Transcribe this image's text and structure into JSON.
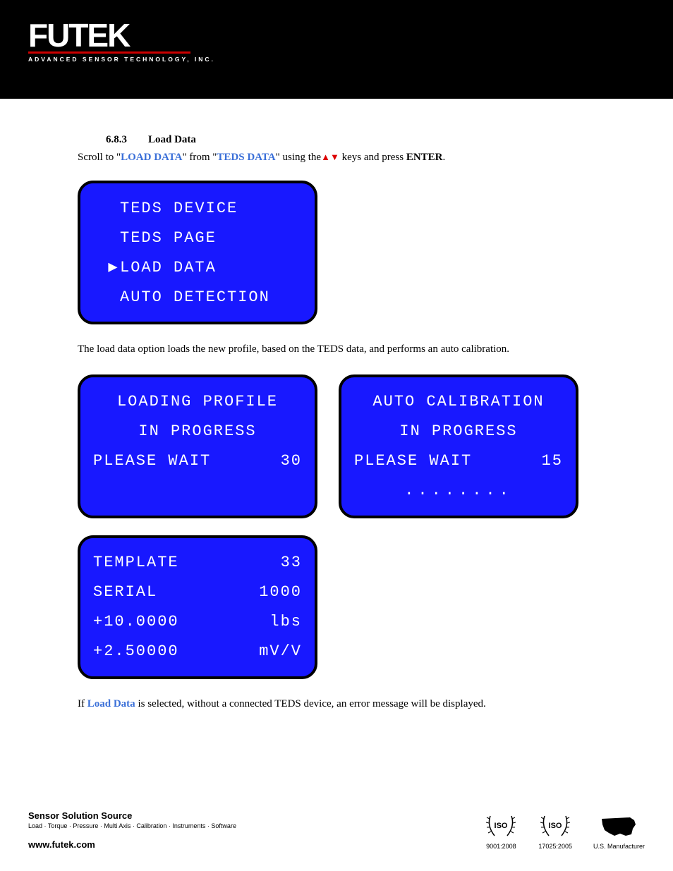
{
  "logo": {
    "main": "FUTEK",
    "sub": "ADVANCED SENSOR TECHNOLOGY, INC."
  },
  "section": {
    "number": "6.8.3",
    "title": "Load Data"
  },
  "intro": {
    "prefix": "Scroll to \"",
    "link1": "LOAD DATA",
    "mid1": "\" from \"",
    "link2": "TEDS DATA",
    "mid2": "\" using the",
    "suffix": " keys and press ",
    "enter": "ENTER",
    "period": "."
  },
  "menu": {
    "item1": "TEDS DEVICE",
    "item2": "TEDS PAGE",
    "cursor": "▶",
    "item3": "LOAD DATA",
    "item4": "AUTO DETECTION"
  },
  "para1": "The load data option loads the new profile, based on the TEDS data, and performs an auto calibration.",
  "loading": {
    "l1": "LOADING PROFILE",
    "l2": "IN PROGRESS",
    "l3a": "PLEASE WAIT",
    "l3b": "30"
  },
  "autocal": {
    "l1": "AUTO CALIBRATION",
    "l2": "IN PROGRESS",
    "l3a": "PLEASE WAIT",
    "l3b": "15",
    "dots": "........"
  },
  "teds_info": {
    "k1": "TEMPLATE",
    "v1": "33",
    "k2": "SERIAL",
    "v2": "1000",
    "k3": "+10.0000",
    "v3": "lbs",
    "k4": "+2.50000",
    "v4": "mV/V"
  },
  "para2": {
    "prefix": "If ",
    "link": "Load Data",
    "suffix": " is selected, without a connected TEDS device, an error message will be displayed."
  },
  "footer": {
    "title": "Sensor Solution Source",
    "sub": "Load · Torque · Pressure · Multi Axis · Calibration · Instruments · Software",
    "url": "www.futek.com",
    "cert1": "9001:2008",
    "cert2": "17025:2005",
    "cert3": "U.S. Manufacturer",
    "iso": "ISO"
  }
}
